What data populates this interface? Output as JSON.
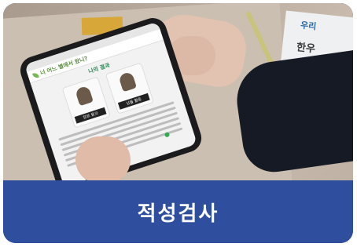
{
  "card": {
    "title": "적성검사"
  },
  "photo": {
    "booklet": {
      "line1": "우리",
      "line2": "한우"
    },
    "phone": {
      "app_title": "너 어느 별에서 왔니?",
      "page_heading": "나의 결과",
      "cards": [
        {
          "label": "장르 뭉크"
        },
        {
          "label": "남들 활동"
        }
      ]
    }
  },
  "colors": {
    "banner": "#2f4f9e",
    "banner_text": "#ffffff"
  }
}
